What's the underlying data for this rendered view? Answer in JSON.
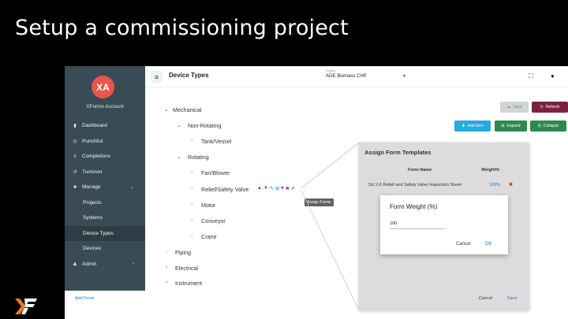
{
  "slide": {
    "title": "Setup a commissioning project",
    "logo_icon": "xf-logo"
  },
  "sidebar": {
    "avatar": "XA",
    "account": "XForms Account",
    "items": [
      {
        "label": "Dashboard",
        "icon": "bar-chart-icon"
      },
      {
        "label": "Punchlist",
        "icon": "clock-icon"
      },
      {
        "label": "Completions",
        "icon": "list-icon"
      },
      {
        "label": "Turnover",
        "icon": "history-icon"
      },
      {
        "label": "Manage",
        "icon": "folder-icon"
      }
    ],
    "manage_sub": [
      "Projects",
      "Systems",
      "Device Types",
      "Devices"
    ],
    "admin": {
      "label": "Admin",
      "icon": "people-icon"
    }
  },
  "header": {
    "title": "Device Types",
    "project_label": "Project",
    "project_value": "AGE Biomass CHP"
  },
  "toolbar": {
    "save": "Save",
    "refresh": "Refresh",
    "add_item": "Add Item",
    "expand": "Expand",
    "collapse": "Collapse"
  },
  "tree": {
    "mechanical": "Mechanical",
    "non_rotating": "Non-Rotating",
    "tank_vessel": "Tank/Vessel",
    "rotating": "Rotating",
    "fan_blower": "Fan/Blower",
    "relief_valve": "Relief/Safety Valve",
    "motor": "Motor",
    "conveyor": "Conveyor",
    "crane": "Crane",
    "piping": "Piping",
    "electrical": "Electrical",
    "instrument": "Instrument"
  },
  "tooltip": "Assign Forms",
  "assign_dialog": {
    "title": "Assign Form Templates",
    "col_name": "Form Name",
    "col_weight": "Weight%",
    "row_name": "SU 2-6 Relief and Safety Valve Inspection Sheet",
    "row_weight": "100%",
    "add_form": "Add Form",
    "cancel": "Cancel",
    "save": "Save"
  },
  "weight_dialog": {
    "title": "Form Weight (%)",
    "value": "100",
    "cancel": "Cancel",
    "ok": "OK"
  },
  "colors": {
    "sidebar": "#394b54",
    "avatar": "#e8554a",
    "refresh": "#7d2144",
    "add_item": "#29a9e0",
    "expand": "#2d8a4e",
    "link": "#1976d2"
  }
}
